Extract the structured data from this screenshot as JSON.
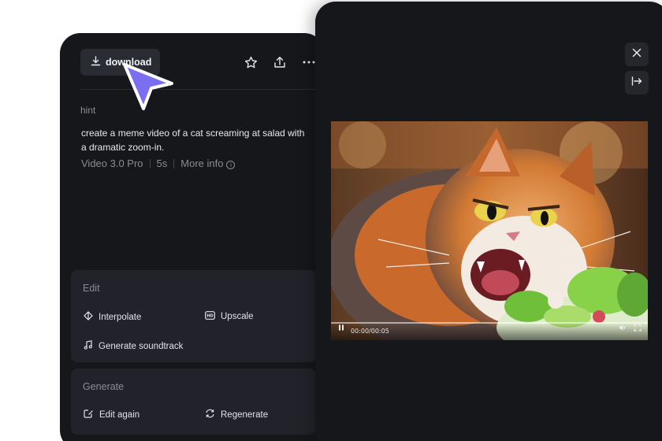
{
  "toolbar": {
    "download_label": "download",
    "icons": [
      "download-icon",
      "star-icon",
      "share-icon",
      "more-icon"
    ]
  },
  "prompt": {
    "hint_label": "hint",
    "text": "create a meme video of a cat screaming at salad with a dramatic zoom-in.",
    "model": "Video 3.0 Pro",
    "duration": "5s",
    "more_info": "More info"
  },
  "edit": {
    "title": "Edit",
    "interpolate": "Interpolate",
    "upscale": "Upscale",
    "soundtrack": "Generate soundtrack"
  },
  "generate": {
    "title": "Generate",
    "edit_again": "Edit again",
    "regenerate": "Regenerate"
  },
  "player": {
    "time": "00:00/00:05",
    "progress": 0.0
  },
  "colors": {
    "panel": "#16171b",
    "card": "#22232a",
    "cursor": "#7b6ff0"
  }
}
